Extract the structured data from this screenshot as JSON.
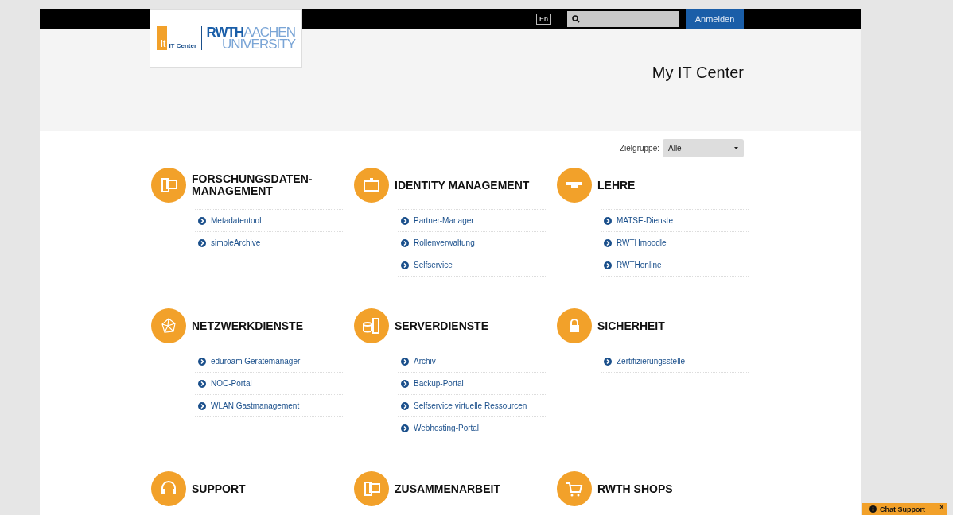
{
  "topbar": {
    "language": "En",
    "login": "Anmelden"
  },
  "logo": {
    "mark": "it",
    "unit": "IT Center",
    "university_bold": "RWTH",
    "university_light": "AACHEN",
    "university_line2": "UNIVERSITY"
  },
  "header": {
    "title": "My IT Center"
  },
  "filter": {
    "label": "Zielgruppe:",
    "value": "Alle"
  },
  "categories": [
    {
      "kind": "monitor",
      "title": "FORSCHUNGSDATEN-MANAGEMENT",
      "links": [
        "Metadatentool",
        "simpleArchive"
      ]
    },
    {
      "kind": "idcard",
      "title": "IDENTITY MANAGEMENT",
      "links": [
        "Partner-Manager",
        "Rollenverwaltung",
        "Selfservice"
      ]
    },
    {
      "kind": "cap",
      "title": "LEHRE",
      "links": [
        "MATSE-Dienste",
        "RWTHmoodle",
        "RWTHonline"
      ]
    },
    {
      "kind": "network",
      "title": "NETZWERKDIENSTE",
      "links": [
        "eduroam Gerätemanager",
        "NOC-Portal",
        "WLAN Gastmanagement"
      ]
    },
    {
      "kind": "server",
      "title": "SERVERDIENSTE",
      "links": [
        "Archiv",
        "Backup-Portal",
        "Selfservice virtuelle Ressourcen",
        "Webhosting-Portal"
      ]
    },
    {
      "kind": "lock",
      "title": "SICHERHEIT",
      "links": [
        "Zertifizierungsstelle"
      ]
    },
    {
      "kind": "headset",
      "title": "SUPPORT"
    },
    {
      "kind": "monitor",
      "title": "ZUSAMMENARBEIT"
    },
    {
      "kind": "cart",
      "title": "RWTH SHOPS"
    }
  ],
  "chat": {
    "label": "Chat Support",
    "close": "x"
  }
}
